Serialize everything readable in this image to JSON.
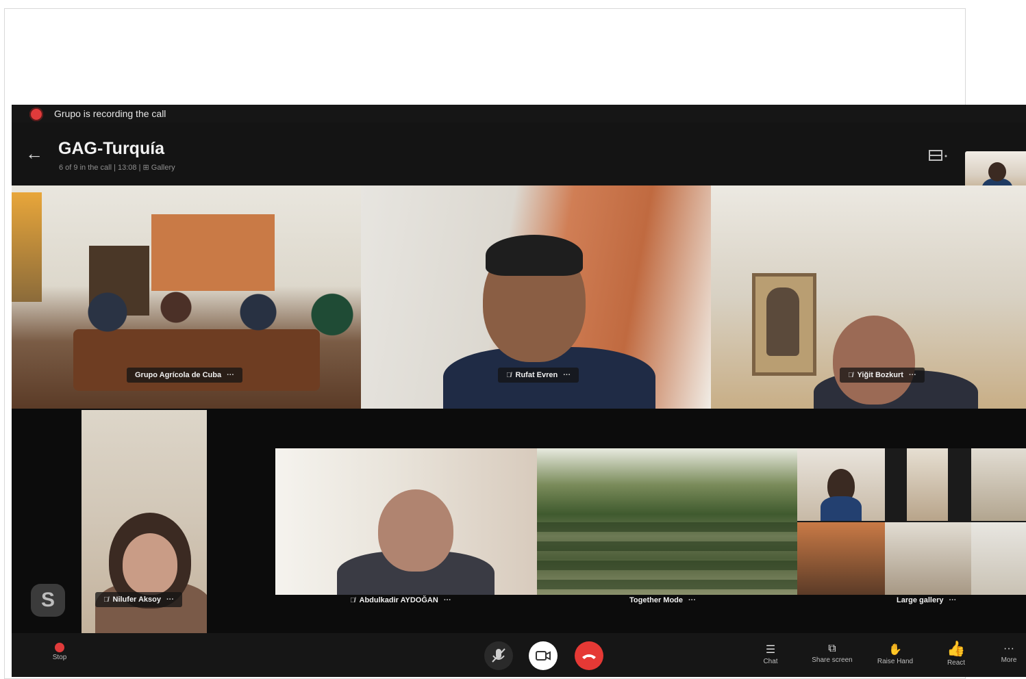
{
  "recording": {
    "text": "Grupo is recording the call",
    "color": "#e03b3b"
  },
  "call": {
    "title": "GAG-Turquía",
    "subtitle": "6 of 9 in the call | 13:08 | ⊞ Gallery"
  },
  "icons": {
    "back": "arrow-left-icon",
    "layout": "layout-icon",
    "mic_off": "mic-off-icon"
  },
  "participants": [
    {
      "name": "Grupo Agrícola de Cuba",
      "more": "···"
    },
    {
      "name": "Rufat Evren",
      "more": "···"
    },
    {
      "name": "Yiğit Bozkurt",
      "more": "···"
    },
    {
      "name": "Nilufer Aksoy",
      "more": "···"
    },
    {
      "name": "Abdulkadir AYDOĞAN",
      "more": "···"
    },
    {
      "name": "Together Mode",
      "more": "···"
    },
    {
      "name": "Large gallery",
      "more": "···"
    }
  ],
  "controls": {
    "stop": "Stop",
    "chat": "Chat",
    "share": "Share screen",
    "raise_hand": "Raise Hand",
    "react": "React",
    "more": "More"
  },
  "skype_badge": "S",
  "colors": {
    "background": "#0c0c0c",
    "hangup": "#e53935",
    "accent_yellow": "#f2c028"
  }
}
